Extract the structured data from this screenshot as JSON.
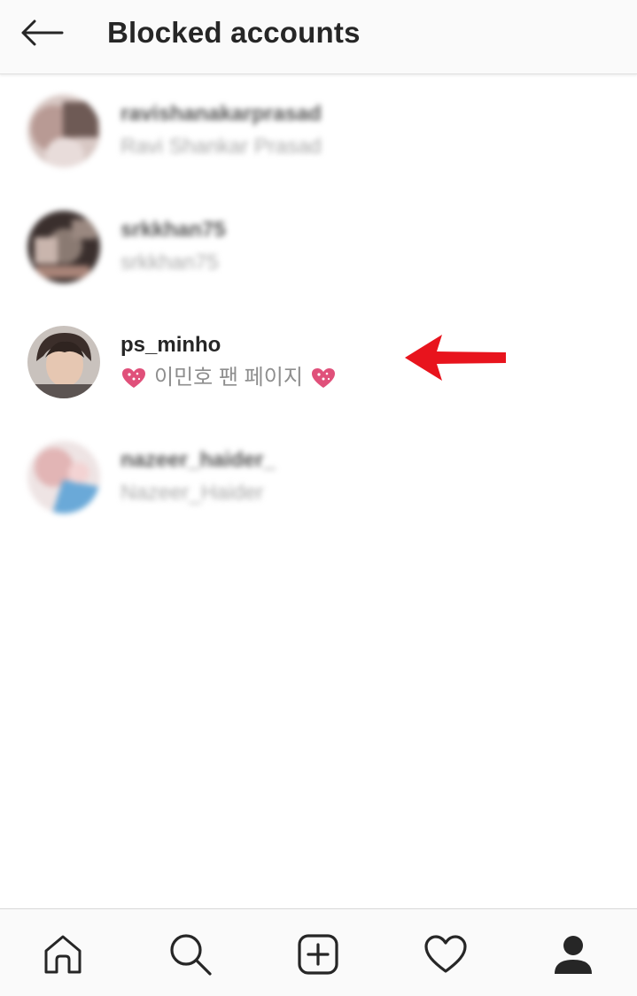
{
  "header": {
    "title": "Blocked accounts",
    "back_icon": "arrow-left-icon"
  },
  "accounts": [
    {
      "username": "ravishanakarprasad",
      "full_name": "Ravi Shankar Prasad",
      "blurred": true
    },
    {
      "username": "srkkhan75",
      "full_name": "srkkhan75",
      "blurred": true
    },
    {
      "username": "ps_minho",
      "full_name": "이민호 팬 페이지",
      "blurred": false,
      "decoration_icon": "sparkling-heart-icon",
      "decoration_color": "#e0507a"
    },
    {
      "username": "nazeer_haider_",
      "full_name": "Nazeer_Haider",
      "blurred": true
    }
  ],
  "annotation": {
    "type": "red-arrow",
    "color": "#e8141d",
    "points_to": "ps_minho"
  },
  "bottom_nav": {
    "items": [
      {
        "icon": "home-icon"
      },
      {
        "icon": "search-icon"
      },
      {
        "icon": "new-post-icon"
      },
      {
        "icon": "heart-icon"
      },
      {
        "icon": "profile-icon",
        "active": true
      }
    ]
  },
  "colors": {
    "header_bg": "#fafafa",
    "text_primary": "#262626",
    "text_secondary": "#8e8e8e"
  }
}
